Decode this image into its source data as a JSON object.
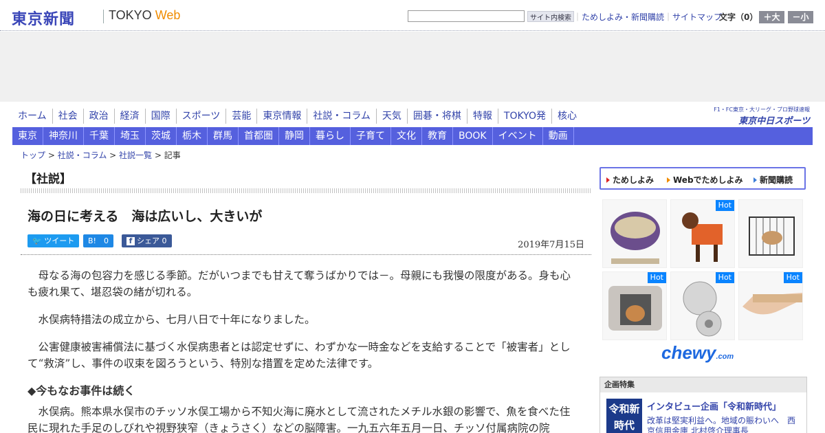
{
  "header": {
    "logo": "東京新聞",
    "logo_en": "TOKYO",
    "logo_web": "Web",
    "search_button": "サイト内検索",
    "links": [
      "ためしよみ・新聞購読",
      "サイトマップ"
    ],
    "fontsize_label": "文字（0）",
    "bigger": "＋大",
    "smaller": "－小"
  },
  "nav_main": [
    "ホーム",
    "社会",
    "政治",
    "経済",
    "国際",
    "スポーツ",
    "芸能",
    "東京情報",
    "社説・コラム",
    "天気",
    "囲碁・将棋",
    "特報",
    "TOKYO発",
    "核心"
  ],
  "chunichi": {
    "small": "F1・FC東京・大リーグ・プロ野球速報",
    "big": "東京中日スポーツ"
  },
  "nav_region": [
    "東京",
    "神奈川",
    "千葉",
    "埼玉",
    "茨城",
    "栃木",
    "群馬",
    "首都圏",
    "静岡",
    "暮らし",
    "子育て",
    "文化",
    "教育",
    "BOOK",
    "イベント",
    "動画"
  ],
  "breadcrumb": {
    "top": "トップ",
    "cat": "社説・コラム",
    "list": "社説一覧",
    "current": "記事",
    "sep": " > "
  },
  "section_title": "【社説】",
  "article": {
    "title": "海の日に考える　海は広いし、大きいが",
    "date": "2019年7月15日",
    "share": {
      "tweet": "ツイート",
      "hatena": "B!　0",
      "facebook": "シェア 0"
    },
    "paragraphs": [
      "母なる海の包容力を感じる季節。だがいつまでも甘えて奪うばかりでは－。母親にも我慢の限度がある。身も心も疲れ果て、堪忍袋の緒が切れる。",
      "水俣病特措法の成立から、七月八日で十年になりました。",
      "公害健康被害補償法に基づく水俣病患者とは認定せずに、わずかな一時金などを支給することで「被害者」として“救済”し、事件の収束を図ろうという、特別な措置を定めた法律です。"
    ],
    "subheading": "◆今もなお事件は続く",
    "paragraph4": "水俣病。熊本県水俣市のチッソ水俣工場から不知火海に廃水として流されたメチル水銀の影響で、魚を食べた住民に現れた手足のしびれや視野狭窄（きょうさく）などの脳障害。一九五六年五月一日、チッソ付属病院の院"
  },
  "sidebar": {
    "subscribe": [
      "ためしよみ",
      "Webでためしよみ",
      "新聞購読"
    ],
    "ad_hot": "Hot",
    "chewy": "chewy",
    "chewy_tld": ".com",
    "promo_head": "企画特集",
    "promo_image": "令和新時代",
    "promo_title": "インタビュー企画「令和新時代」",
    "promo_sub": "改革は堅実利益へ。地域の賑わいへ　西京信用金庫 北村啓介理事長"
  }
}
